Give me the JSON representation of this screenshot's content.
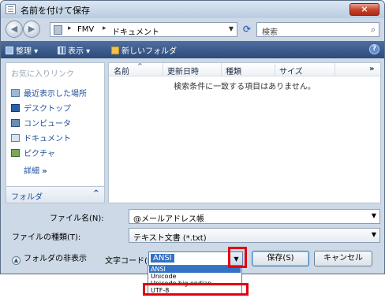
{
  "window": {
    "title": "名前を付けて保存",
    "close_label": "×"
  },
  "address": {
    "crumbs": [
      "FMV",
      "ドキュメント"
    ],
    "separator": "▸",
    "search_placeholder": "検索"
  },
  "toolbar": {
    "organize": "整理",
    "views": "表示",
    "new_folder": "新しいフォルダ",
    "help": "?"
  },
  "left_pane": {
    "header": "お気に入りリンク",
    "links": [
      {
        "label": "最近表示した場所",
        "icon": "recent-places-icon"
      },
      {
        "label": "デスクトップ",
        "icon": "desktop-icon"
      },
      {
        "label": "コンピュータ",
        "icon": "computer-icon"
      },
      {
        "label": "ドキュメント",
        "icon": "documents-icon"
      },
      {
        "label": "ピクチャ",
        "icon": "pictures-icon"
      }
    ],
    "details": "詳細",
    "details_chevron": "»",
    "folders": "フォルダ",
    "folders_caret": "^"
  },
  "file_list": {
    "columns": [
      "名前",
      "更新日時",
      "種類",
      "サイズ"
    ],
    "more": "»",
    "empty_message": "検索条件に一致する項目はありません。"
  },
  "form": {
    "filename_label": "ファイル名(N):",
    "filename_value": "@メールアドレス帳",
    "filetype_label": "ファイルの種類(T):",
    "filetype_value": "テキスト文書 (*.txt)",
    "hide_folders": "フォルダの非表示",
    "encoding_label": "文字コード(E):",
    "encoding_value": "ANSI",
    "save": "保存(S)",
    "cancel": "キャンセル"
  },
  "encoding_options": [
    "ANSI",
    "Unicode",
    "Unicode big endian",
    "UTF-8"
  ],
  "colors": {
    "highlight": "#e4000f",
    "selection": "#3372c4",
    "toolbar": "#3a5a8c",
    "link": "#1f4f9a"
  }
}
